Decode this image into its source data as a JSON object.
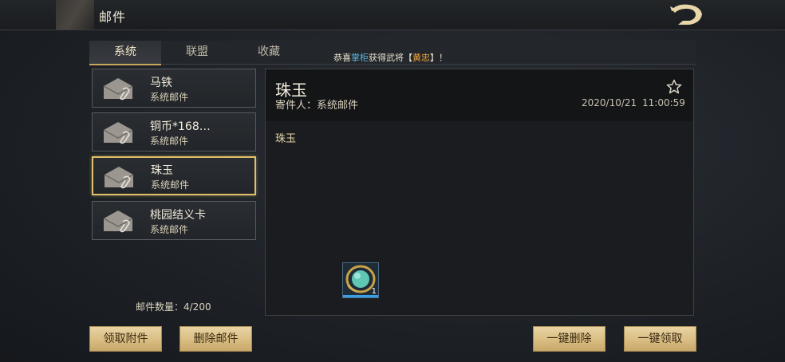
{
  "header": {
    "title": "邮件"
  },
  "tabs": [
    {
      "label": "系统"
    },
    {
      "label": "联盟"
    },
    {
      "label": "收藏"
    }
  ],
  "marquee": {
    "prefix": "恭喜",
    "player": "掌柜",
    "middle": "获得武将",
    "bracket_open": "【",
    "hero": "黄忠",
    "bracket_close": "】！"
  },
  "mail_list": {
    "items": [
      {
        "title": "马铁",
        "sender": "系统邮件"
      },
      {
        "title": "铜币*168…",
        "sender": "系统邮件"
      },
      {
        "title": "珠玉",
        "sender": "系统邮件"
      },
      {
        "title": "桃园结义卡",
        "sender": "系统邮件"
      }
    ],
    "selected_index": 2,
    "count_label": "邮件数量：4/200"
  },
  "detail": {
    "title": "珠玉",
    "sender_label": "寄件人：系统邮件",
    "date": "2020/10/21",
    "time": "11:00:59",
    "body": "珠玉",
    "attachment": {
      "icon": "jade-orb-icon",
      "quantity": "1"
    }
  },
  "buttons": {
    "claim_attachments": "领取附件",
    "delete_mail": "删除邮件",
    "delete_all": "一键删除",
    "claim_all": "一键领取"
  },
  "colors": {
    "accent_gold": "#e0bf6a",
    "button_bg": "#d9bd83",
    "highlight_orange": "#f2a63a"
  }
}
